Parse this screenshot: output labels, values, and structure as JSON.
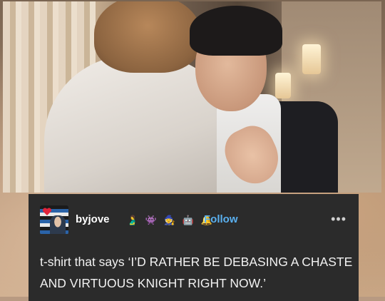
{
  "post": {
    "username": "byjove",
    "follow_label": "Follow",
    "more_label": "•••",
    "badges": [
      "🫃",
      "👾",
      "🧙",
      "🤖",
      "🔔"
    ],
    "text": "t-shirt that says ‘I’D RATHER BE DEBASING A CHASTE AND VIRTUOUS KNIGHT RIGHT NOW.’"
  },
  "colors": {
    "card_bg": "#2b2b2b",
    "follow_blue": "#5ab0f0",
    "text": "#f2f2f2"
  }
}
